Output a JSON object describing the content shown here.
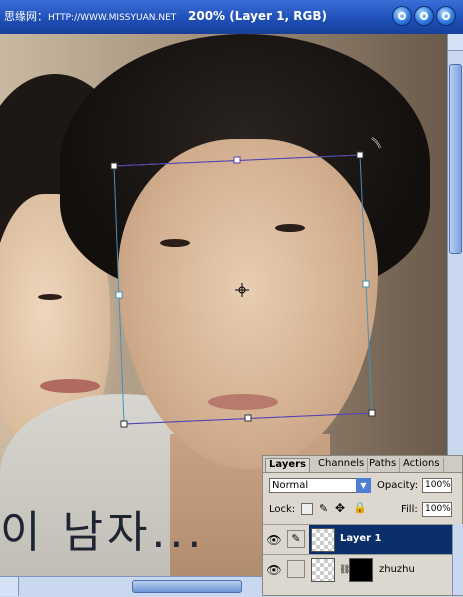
{
  "titlebar": {
    "watermark_prefix": "思缘网：",
    "watermark_url": "HTTP://WWW.MISSYUAN.NET",
    "title": "200% (Layer 1, RGB)",
    "buttons": [
      "minimize",
      "maximize",
      "close"
    ]
  },
  "canvas": {
    "overlay_text": "이 남자...",
    "transform_handles": "free-transform-bounding-box"
  },
  "layers_panel": {
    "tabs": [
      {
        "label": "Layers",
        "active": true
      },
      {
        "label": "Channels",
        "active": false
      },
      {
        "label": "Paths",
        "active": false
      },
      {
        "label": "Actions",
        "active": false
      }
    ],
    "blend_mode": "Normal",
    "opacity_label": "Opacity:",
    "opacity_value": "100%",
    "lock_label": "Lock:",
    "fill_label": "Fill:",
    "fill_value": "100%",
    "layers": [
      {
        "name": "Layer 1",
        "selected": true,
        "visible": true
      },
      {
        "name": "zhuzhu",
        "selected": false,
        "visible": true
      }
    ]
  },
  "colors": {
    "titlebar": "#1f4fb8",
    "selected_layer": "#0a2f6b",
    "transform_box": "#4a90b8"
  }
}
